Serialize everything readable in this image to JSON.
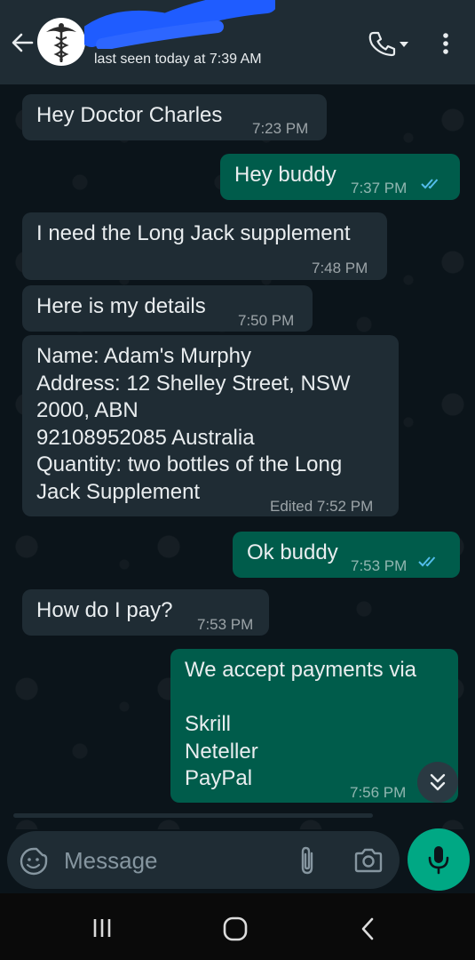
{
  "header": {
    "last_seen": "last seen today at 7:39 AM",
    "avatar_icon": "caduceus-icon",
    "accent_color": "#53bdeb"
  },
  "messages": [
    {
      "direction": "incoming",
      "text": "Hey Doctor Charles",
      "time": "7:23 PM"
    },
    {
      "direction": "outgoing",
      "text": "Hey buddy",
      "time": "7:37 PM",
      "status": "read"
    },
    {
      "direction": "incoming",
      "text": "I need the Long Jack supplement",
      "time": "7:48 PM"
    },
    {
      "direction": "incoming",
      "text": "Here is my details",
      "time": "7:50 PM"
    },
    {
      "direction": "incoming",
      "text": "Name: Adam's Murphy\nAddress: 12 Shelley Street, NSW\n2000, ABN\n92108952085 Australia\nQuantity: two bottles of the Long\nJack Supplement",
      "time": "Edited 7:52 PM"
    },
    {
      "direction": "outgoing",
      "text": "Ok buddy",
      "time": "7:53 PM",
      "status": "read"
    },
    {
      "direction": "incoming",
      "text": "How do I pay?",
      "time": "7:53 PM"
    },
    {
      "direction": "outgoing",
      "text": "We accept payments via\n\nSkrill\nNeteller\nPayPal",
      "time": "7:56 PM"
    }
  ],
  "input": {
    "placeholder": "Message"
  },
  "colors": {
    "incoming_bubble": "#1f2c34",
    "outgoing_bubble": "#005c4b",
    "send_button": "#00a884",
    "read_ticks": "#53bdeb"
  }
}
